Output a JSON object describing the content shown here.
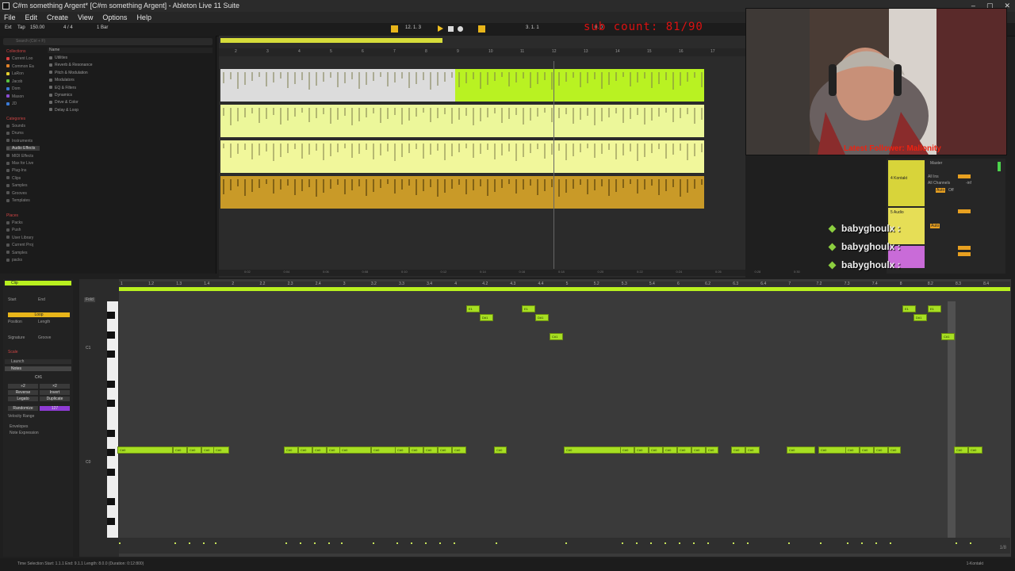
{
  "window": {
    "title": "C#m something Argent* [C#m something Argent] - Ableton Live 11 Suite",
    "buttons": [
      "–",
      "▢",
      "✕"
    ]
  },
  "menu": [
    "File",
    "Edit",
    "Create",
    "View",
    "Options",
    "Help"
  ],
  "transport": {
    "ext": "Ext",
    "tap": "Tap",
    "tempo": "150.00",
    "signature": "4 / 4",
    "bars": "1 Bar",
    "position": "12. 1. 3",
    "position2": "3. 1. 1",
    "position3": "0. 0"
  },
  "overlay": {
    "sub_count": "sub count: 81/90",
    "latest_follower": "Latest Follower: Mallonity",
    "chat_user": "babyghoulx :"
  },
  "browser": {
    "search_placeholder": "Search (Ctrl + F)",
    "name_header": "Name",
    "collections_head": "Collections",
    "collections": [
      {
        "label": "Current Loo",
        "color": "#d94040"
      },
      {
        "label": "Common Ea",
        "color": "#e0822a"
      },
      {
        "label": "LaRon",
        "color": "#e6d02e"
      },
      {
        "label": "Jacob",
        "color": "#58c040"
      },
      {
        "label": "Dom",
        "color": "#3a7ad6"
      },
      {
        "label": "Mason",
        "color": "#8a4cd0"
      },
      {
        "label": "JD",
        "color": "#3a7ad6"
      }
    ],
    "categories_head": "Categories",
    "categories": [
      "Sounds",
      "Drums",
      "Instruments",
      "Audio Effects",
      "MIDI Effects",
      "Max for Live",
      "Plug-Ins",
      "Clips",
      "Samples",
      "Grooves",
      "Templates"
    ],
    "places_head": "Places",
    "places": [
      "Packs",
      "Push",
      "User Library",
      "Current Proj",
      "Samples",
      "packs"
    ],
    "items": [
      "Utilities",
      "Reverb & Resonance",
      "Pitch & Modulation",
      "Modulators",
      "EQ & Filters",
      "Dynamics",
      "Drive & Color",
      "Delay & Loop"
    ]
  },
  "arrangement": {
    "ruler": [
      "2",
      "3",
      "4",
      "5",
      "6",
      "7",
      "8",
      "9",
      "10",
      "11",
      "12",
      "13",
      "14",
      "15",
      "16",
      "17"
    ],
    "time": [
      "0:02",
      "0:04",
      "0:06",
      "0:08",
      "0:10",
      "0:12",
      "0:14",
      "0:16",
      "0:18",
      "0:20",
      "0:22",
      "0:24",
      "0:26",
      "0:28",
      "0:30"
    ],
    "colors": {
      "track1_left": "#dcdcdc",
      "track1_right": "#b9f222",
      "track2": "#ecf79a",
      "track3": "#f1f79b",
      "track4": "#c99a28"
    }
  },
  "mixer": {
    "track1": "4 Kontakt",
    "track2": "5 Audio",
    "master": "Master",
    "in": "All Ins",
    "channels": "All Channels",
    "auto": "Auto",
    "off": "Off",
    "inf": "-inf"
  },
  "clip_panel": {
    "title": "Clip",
    "start_label": "Start",
    "end_label": "End",
    "loop": "Loop",
    "position_label": "Position",
    "length_label": "Length",
    "signature_label": "Signature",
    "groove_label": "Groove",
    "scale_label": "Scale",
    "launch": "Launch",
    "notes": "Notes",
    "note_range": "C#1",
    "pitch_buttons": [
      "÷2",
      "×2"
    ],
    "reverse": "Reverse",
    "invert": "Invert",
    "legato": "Legato",
    "duplicate": "Duplicate",
    "randomize": "Randomize",
    "rand_value": "127",
    "velocity_range": "Velocity Range",
    "envelopes": "Envelopes",
    "note_expression": "Note Expression"
  },
  "piano_roll": {
    "fold": "Fold",
    "key_c1": "C1",
    "key_c0": "C0",
    "ruler": [
      "1",
      "1.2",
      "1.3",
      "1.4",
      "2",
      "2.2",
      "2.3",
      "2.4",
      "3",
      "3.2",
      "3.3",
      "3.4",
      "4",
      "4.2",
      "4.3",
      "4.4",
      "5",
      "5.2",
      "5.3",
      "5.4",
      "6",
      "6.2",
      "6.3",
      "6.4",
      "7",
      "7.2",
      "7.3",
      "7.4",
      "8",
      "8.2",
      "8.3",
      "8.4"
    ],
    "note_c0": "C#0",
    "note_e1": "E1",
    "note_d1": "D#1",
    "note_c1": "C#1",
    "grid": "1/8"
  },
  "status": {
    "left": "Time Selection   Start: 1.1.1   End: 9.1.1   Length: 8.0.0 (Duration: 0:12:800)",
    "right": "1-Kontakt"
  }
}
